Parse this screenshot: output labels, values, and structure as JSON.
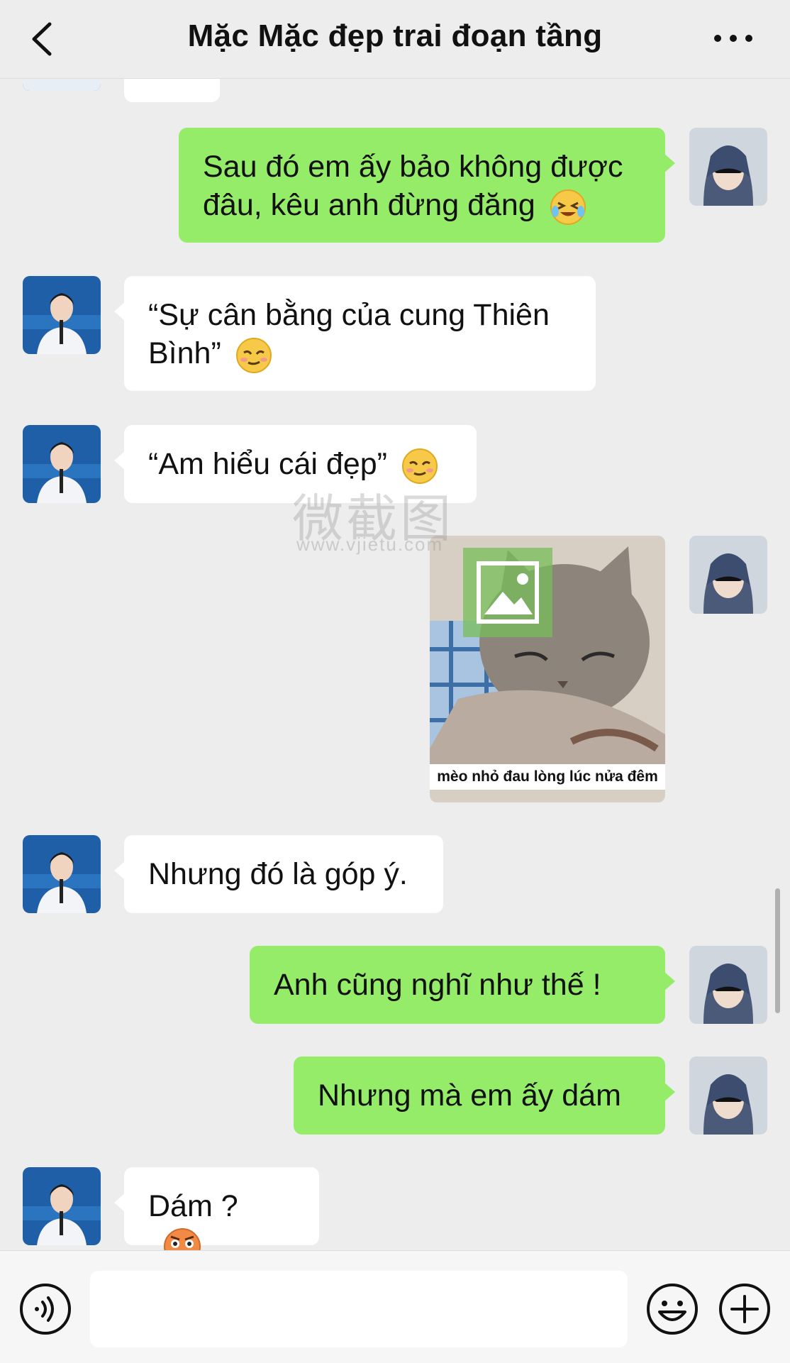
{
  "header": {
    "title": "Mặc Mặc đẹp trai đoạn tầng"
  },
  "messages": [
    {
      "side": "right",
      "text": "Sau đó em ấy bảo không được đâu, kêu anh đừng đăng",
      "emoji": "laughing-tears-emoji"
    },
    {
      "side": "left",
      "text": "“Sự cân bằng của cung Thiên Bình”",
      "emoji": "smug-emoji"
    },
    {
      "side": "left",
      "text": "“Am hiểu cái đẹp”",
      "emoji": "smug-emoji"
    },
    {
      "side": "right",
      "type": "sticker",
      "caption": "mèo nhỏ đau lòng lúc nửa đêm"
    },
    {
      "side": "left",
      "text": "Nhưng đó là góp ý."
    },
    {
      "side": "right",
      "text": "Anh cũng nghĩ như thế !"
    },
    {
      "side": "right",
      "text": "Nhưng mà em ấy dám"
    },
    {
      "side": "left",
      "text": "Dám ?",
      "emoji": "shocked-sweat-emoji"
    }
  ],
  "watermark": {
    "text": "微截图",
    "url": "www.vjietu.com"
  },
  "input": {
    "value": ""
  },
  "colors": {
    "background": "#ededed",
    "sent_bubble": "#95ec69",
    "received_bubble": "#ffffff"
  }
}
